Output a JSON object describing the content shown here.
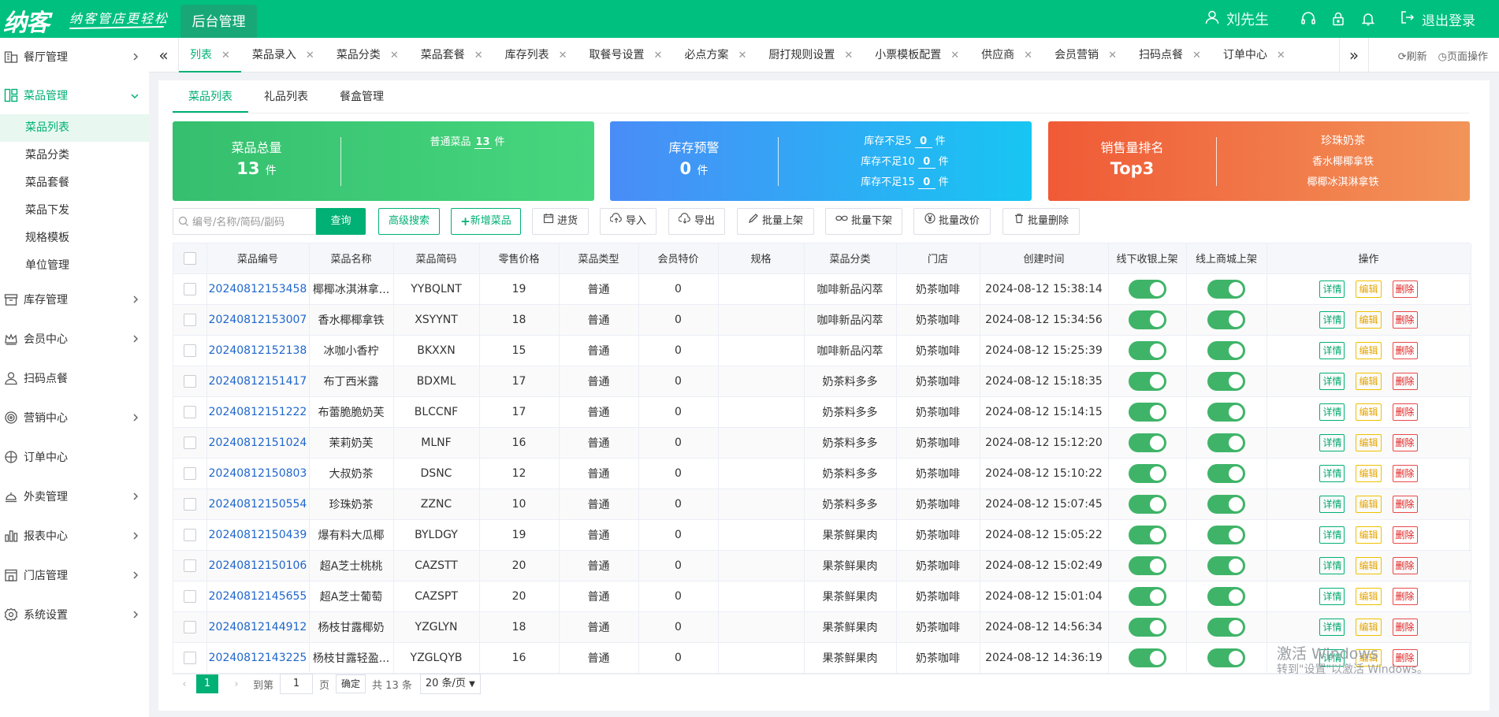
{
  "brand": {
    "logo": "纳客",
    "slogan": "纳客管店更轻松"
  },
  "header": {
    "admin_tab": "后台管理",
    "user_name": "刘先生",
    "logout": "退出登录"
  },
  "sidebar": {
    "menus": [
      "餐厅管理",
      "菜品管理",
      "库存管理",
      "会员中心",
      "扫码点餐",
      "营销中心",
      "订单中心",
      "外卖管理",
      "报表中心",
      "门店管理",
      "系统设置"
    ],
    "dish_submenu": [
      "菜品列表",
      "菜品分类",
      "菜品套餐",
      "菜品下发",
      "规格模板",
      "单位管理"
    ]
  },
  "tabbar": {
    "tabs": [
      "列表",
      "菜品录入",
      "菜品分类",
      "菜品套餐",
      "库存列表",
      "取餐号设置",
      "必点方案",
      "厨打规则设置",
      "小票模板配置",
      "供应商",
      "会员营销",
      "扫码点餐",
      "订单中心"
    ],
    "refresh": "刷新",
    "page_ops": "页面操作"
  },
  "subtabs": [
    "菜品列表",
    "礼品列表",
    "餐盒管理"
  ],
  "stats": {
    "total": {
      "title": "菜品总量",
      "value": "13",
      "unit": "件",
      "normal_label": "普通菜品",
      "normal_value": "13"
    },
    "stock": {
      "title": "库存预警",
      "value": "0",
      "unit": "件",
      "lines": [
        {
          "label": "库存不足5",
          "value": "0"
        },
        {
          "label": "库存不足10",
          "value": "0"
        },
        {
          "label": "库存不足15",
          "value": "0"
        }
      ]
    },
    "sales": {
      "title": "销售量排名",
      "value": "Top3",
      "items": [
        "珍珠奶茶",
        "香水椰椰拿铁",
        "椰椰冰淇淋拿铁"
      ]
    }
  },
  "toolbar": {
    "search_placeholder": "编号/名称/简码/副码",
    "query": "查询",
    "advanced": "高级搜索",
    "add": "新增菜品",
    "stock_in": "进货",
    "import": "导入",
    "export": "导出",
    "batch_on": "批量上架",
    "batch_off": "批量下架",
    "batch_price": "批量改价",
    "batch_delete": "批量删除"
  },
  "table": {
    "columns": [
      "",
      "菜品编号",
      "菜品名称",
      "菜品简码",
      "零售价格",
      "菜品类型",
      "会员特价",
      "规格",
      "菜品分类",
      "门店",
      "创建时间",
      "线下收银上架",
      "线上商城上架",
      "操作"
    ],
    "ops": {
      "detail": "详情",
      "edit": "编辑",
      "delete": "删除"
    },
    "rows": [
      {
        "code": "20240812153458",
        "name": "椰椰冰淇淋拿...",
        "short": "YYBQLNT",
        "price": "19",
        "type": "普通",
        "member": "0",
        "spec": "",
        "category": "咖啡新品闪萃",
        "store": "奶茶咖啡",
        "time": "2024-08-12 15:38:14"
      },
      {
        "code": "20240812153007",
        "name": "香水椰椰拿铁",
        "short": "XSYYNT",
        "price": "18",
        "type": "普通",
        "member": "0",
        "spec": "",
        "category": "咖啡新品闪萃",
        "store": "奶茶咖啡",
        "time": "2024-08-12 15:34:56"
      },
      {
        "code": "20240812152138",
        "name": "冰咖小香柠",
        "short": "BKXXN",
        "price": "15",
        "type": "普通",
        "member": "0",
        "spec": "",
        "category": "咖啡新品闪萃",
        "store": "奶茶咖啡",
        "time": "2024-08-12 15:25:39"
      },
      {
        "code": "20240812151417",
        "name": "布丁西米露",
        "short": "BDXML",
        "price": "17",
        "type": "普通",
        "member": "0",
        "spec": "",
        "category": "奶茶料多多",
        "store": "奶茶咖啡",
        "time": "2024-08-12 15:18:35"
      },
      {
        "code": "20240812151222",
        "name": "布蕾脆脆奶芙",
        "short": "BLCCNF",
        "price": "17",
        "type": "普通",
        "member": "0",
        "spec": "",
        "category": "奶茶料多多",
        "store": "奶茶咖啡",
        "time": "2024-08-12 15:14:15"
      },
      {
        "code": "20240812151024",
        "name": "茉莉奶芙",
        "short": "MLNF",
        "price": "16",
        "type": "普通",
        "member": "0",
        "spec": "",
        "category": "奶茶料多多",
        "store": "奶茶咖啡",
        "time": "2024-08-12 15:12:20"
      },
      {
        "code": "20240812150803",
        "name": "大叔奶茶",
        "short": "DSNC",
        "price": "12",
        "type": "普通",
        "member": "0",
        "spec": "",
        "category": "奶茶料多多",
        "store": "奶茶咖啡",
        "time": "2024-08-12 15:10:22"
      },
      {
        "code": "20240812150554",
        "name": "珍珠奶茶",
        "short": "ZZNC",
        "price": "10",
        "type": "普通",
        "member": "0",
        "spec": "",
        "category": "奶茶料多多",
        "store": "奶茶咖啡",
        "time": "2024-08-12 15:07:45"
      },
      {
        "code": "20240812150439",
        "name": "爆有料大瓜椰",
        "short": "BYLDGY",
        "price": "19",
        "type": "普通",
        "member": "0",
        "spec": "",
        "category": "果茶鲜果肉",
        "store": "奶茶咖啡",
        "time": "2024-08-12 15:05:22"
      },
      {
        "code": "20240812150106",
        "name": "超A芝士桃桃",
        "short": "CAZSTT",
        "price": "20",
        "type": "普通",
        "member": "0",
        "spec": "",
        "category": "果茶鲜果肉",
        "store": "奶茶咖啡",
        "time": "2024-08-12 15:02:49"
      },
      {
        "code": "20240812145655",
        "name": "超A芝士葡萄",
        "short": "CAZSPT",
        "price": "20",
        "type": "普通",
        "member": "0",
        "spec": "",
        "category": "果茶鲜果肉",
        "store": "奶茶咖啡",
        "time": "2024-08-12 15:01:04"
      },
      {
        "code": "20240812144912",
        "name": "杨枝甘露椰奶",
        "short": "YZGLYN",
        "price": "18",
        "type": "普通",
        "member": "0",
        "spec": "",
        "category": "果茶鲜果肉",
        "store": "奶茶咖啡",
        "time": "2024-08-12 14:56:34"
      },
      {
        "code": "20240812143225",
        "name": "杨枝甘露轻盈...",
        "short": "YZGLQYB",
        "price": "16",
        "type": "普通",
        "member": "0",
        "spec": "",
        "category": "果茶鲜果肉",
        "store": "奶茶咖啡",
        "time": "2024-08-12 14:36:19"
      }
    ]
  },
  "pagination": {
    "current": "1",
    "goto_label": "到第",
    "goto_value": "1",
    "page_label": "页",
    "confirm": "确定",
    "total": "共 13 条",
    "page_size": "20 条/页"
  },
  "watermark": {
    "line1": "激活 Windows",
    "line2": "转到\"设置\"以激活 Windows。"
  },
  "colors": {
    "brand": "#00c080",
    "accent": "#00b074",
    "card_green": "#3cc47a",
    "card_blue": "#2ea6f5",
    "card_orange": "#f26d40"
  }
}
